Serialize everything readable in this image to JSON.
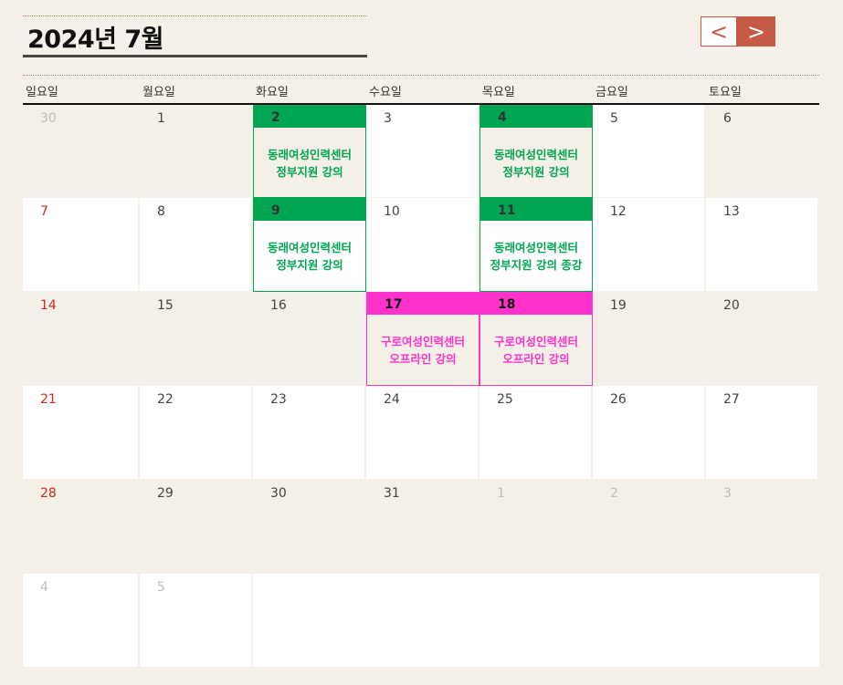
{
  "header": {
    "title": "2024년 7월",
    "prev_label": "<",
    "next_label": ">"
  },
  "weekdays": [
    "일요일",
    "월요일",
    "화요일",
    "수요일",
    "목요일",
    "금요일",
    "토요일"
  ],
  "colors": {
    "event_green": "#00a651",
    "event_pink": "#ff33cc",
    "accent": "#c55a47",
    "sunday": "#c72a1e"
  },
  "weeks": [
    [
      {
        "day": "30"
      },
      {
        "day": "1"
      },
      {
        "day": "2",
        "event": {
          "line1": "동래여성인력센터",
          "line2": "정부지원 강의"
        }
      },
      {
        "day": "3"
      },
      {
        "day": "4",
        "event": {
          "line1": "동래여성인력센터",
          "line2": "정부지원 강의"
        }
      },
      {
        "day": "5"
      },
      {
        "day": "6"
      }
    ],
    [
      {
        "day": "7"
      },
      {
        "day": "8"
      },
      {
        "day": "9",
        "event": {
          "line1": "동래여성인력센터",
          "line2": "정부지원 강의"
        }
      },
      {
        "day": "10"
      },
      {
        "day": "11",
        "event": {
          "line1": "동래여성인력센터",
          "line2": "정부지원 강의 종강"
        }
      },
      {
        "day": "12"
      },
      {
        "day": "13"
      }
    ],
    [
      {
        "day": "14"
      },
      {
        "day": "15"
      },
      {
        "day": "16"
      },
      {
        "day": "17",
        "event": {
          "line1": "구로여성인력센터",
          "line2": "오프라인 강의"
        }
      },
      {
        "day": "18",
        "event": {
          "line1": "구로여성인력센터",
          "line2": "오프라인 강의"
        }
      },
      {
        "day": "19"
      },
      {
        "day": "20"
      }
    ],
    [
      {
        "day": "21"
      },
      {
        "day": "22"
      },
      {
        "day": "23"
      },
      {
        "day": "24"
      },
      {
        "day": "25"
      },
      {
        "day": "26"
      },
      {
        "day": "27"
      }
    ],
    [
      {
        "day": "28"
      },
      {
        "day": "29"
      },
      {
        "day": "30"
      },
      {
        "day": "31"
      },
      {
        "day": "1"
      },
      {
        "day": "2"
      },
      {
        "day": "3"
      }
    ],
    [
      {
        "day": "4"
      },
      {
        "day": "5"
      }
    ]
  ]
}
